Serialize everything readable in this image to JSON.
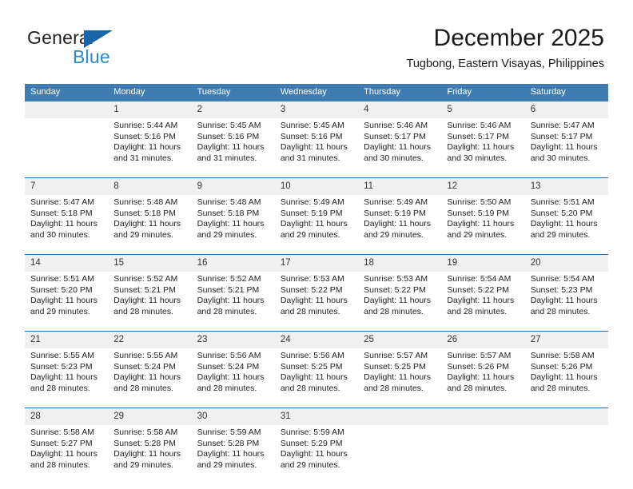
{
  "logo": {
    "word_primary": "General",
    "word_secondary": "Blue",
    "icon": "triangle-mark"
  },
  "header": {
    "title": "December 2025",
    "subtitle": "Tugbong, Eastern Visayas, Philippines"
  },
  "colors": {
    "header_blue": "#3e7cb1",
    "rule_blue": "#2f6fa8",
    "daynum_band": "#f0f0f0",
    "logo_blue": "#2b8ad6",
    "logo_triangle": "#1565a8",
    "text": "#222222"
  },
  "weekday_headers": [
    "Sunday",
    "Monday",
    "Tuesday",
    "Wednesday",
    "Thursday",
    "Friday",
    "Saturday"
  ],
  "labels": {
    "sunrise_prefix": "Sunrise:",
    "sunset_prefix": "Sunset:",
    "daylight_prefix": "Daylight:"
  },
  "weeks": [
    {
      "days": [
        {
          "num": "",
          "sunrise": "",
          "sunset": "",
          "daylight_1": "",
          "daylight_2": "",
          "empty": true
        },
        {
          "num": "1",
          "sunrise": "Sunrise: 5:44 AM",
          "sunset": "Sunset: 5:16 PM",
          "daylight_1": "Daylight: 11 hours",
          "daylight_2": "and 31 minutes.",
          "empty": false
        },
        {
          "num": "2",
          "sunrise": "Sunrise: 5:45 AM",
          "sunset": "Sunset: 5:16 PM",
          "daylight_1": "Daylight: 11 hours",
          "daylight_2": "and 31 minutes.",
          "empty": false
        },
        {
          "num": "3",
          "sunrise": "Sunrise: 5:45 AM",
          "sunset": "Sunset: 5:16 PM",
          "daylight_1": "Daylight: 11 hours",
          "daylight_2": "and 31 minutes.",
          "empty": false
        },
        {
          "num": "4",
          "sunrise": "Sunrise: 5:46 AM",
          "sunset": "Sunset: 5:17 PM",
          "daylight_1": "Daylight: 11 hours",
          "daylight_2": "and 30 minutes.",
          "empty": false
        },
        {
          "num": "5",
          "sunrise": "Sunrise: 5:46 AM",
          "sunset": "Sunset: 5:17 PM",
          "daylight_1": "Daylight: 11 hours",
          "daylight_2": "and 30 minutes.",
          "empty": false
        },
        {
          "num": "6",
          "sunrise": "Sunrise: 5:47 AM",
          "sunset": "Sunset: 5:17 PM",
          "daylight_1": "Daylight: 11 hours",
          "daylight_2": "and 30 minutes.",
          "empty": false
        }
      ]
    },
    {
      "days": [
        {
          "num": "7",
          "sunrise": "Sunrise: 5:47 AM",
          "sunset": "Sunset: 5:18 PM",
          "daylight_1": "Daylight: 11 hours",
          "daylight_2": "and 30 minutes.",
          "empty": false
        },
        {
          "num": "8",
          "sunrise": "Sunrise: 5:48 AM",
          "sunset": "Sunset: 5:18 PM",
          "daylight_1": "Daylight: 11 hours",
          "daylight_2": "and 29 minutes.",
          "empty": false
        },
        {
          "num": "9",
          "sunrise": "Sunrise: 5:48 AM",
          "sunset": "Sunset: 5:18 PM",
          "daylight_1": "Daylight: 11 hours",
          "daylight_2": "and 29 minutes.",
          "empty": false
        },
        {
          "num": "10",
          "sunrise": "Sunrise: 5:49 AM",
          "sunset": "Sunset: 5:19 PM",
          "daylight_1": "Daylight: 11 hours",
          "daylight_2": "and 29 minutes.",
          "empty": false
        },
        {
          "num": "11",
          "sunrise": "Sunrise: 5:49 AM",
          "sunset": "Sunset: 5:19 PM",
          "daylight_1": "Daylight: 11 hours",
          "daylight_2": "and 29 minutes.",
          "empty": false
        },
        {
          "num": "12",
          "sunrise": "Sunrise: 5:50 AM",
          "sunset": "Sunset: 5:19 PM",
          "daylight_1": "Daylight: 11 hours",
          "daylight_2": "and 29 minutes.",
          "empty": false
        },
        {
          "num": "13",
          "sunrise": "Sunrise: 5:51 AM",
          "sunset": "Sunset: 5:20 PM",
          "daylight_1": "Daylight: 11 hours",
          "daylight_2": "and 29 minutes.",
          "empty": false
        }
      ]
    },
    {
      "days": [
        {
          "num": "14",
          "sunrise": "Sunrise: 5:51 AM",
          "sunset": "Sunset: 5:20 PM",
          "daylight_1": "Daylight: 11 hours",
          "daylight_2": "and 29 minutes.",
          "empty": false
        },
        {
          "num": "15",
          "sunrise": "Sunrise: 5:52 AM",
          "sunset": "Sunset: 5:21 PM",
          "daylight_1": "Daylight: 11 hours",
          "daylight_2": "and 28 minutes.",
          "empty": false
        },
        {
          "num": "16",
          "sunrise": "Sunrise: 5:52 AM",
          "sunset": "Sunset: 5:21 PM",
          "daylight_1": "Daylight: 11 hours",
          "daylight_2": "and 28 minutes.",
          "empty": false
        },
        {
          "num": "17",
          "sunrise": "Sunrise: 5:53 AM",
          "sunset": "Sunset: 5:22 PM",
          "daylight_1": "Daylight: 11 hours",
          "daylight_2": "and 28 minutes.",
          "empty": false
        },
        {
          "num": "18",
          "sunrise": "Sunrise: 5:53 AM",
          "sunset": "Sunset: 5:22 PM",
          "daylight_1": "Daylight: 11 hours",
          "daylight_2": "and 28 minutes.",
          "empty": false
        },
        {
          "num": "19",
          "sunrise": "Sunrise: 5:54 AM",
          "sunset": "Sunset: 5:22 PM",
          "daylight_1": "Daylight: 11 hours",
          "daylight_2": "and 28 minutes.",
          "empty": false
        },
        {
          "num": "20",
          "sunrise": "Sunrise: 5:54 AM",
          "sunset": "Sunset: 5:23 PM",
          "daylight_1": "Daylight: 11 hours",
          "daylight_2": "and 28 minutes.",
          "empty": false
        }
      ]
    },
    {
      "days": [
        {
          "num": "21",
          "sunrise": "Sunrise: 5:55 AM",
          "sunset": "Sunset: 5:23 PM",
          "daylight_1": "Daylight: 11 hours",
          "daylight_2": "and 28 minutes.",
          "empty": false
        },
        {
          "num": "22",
          "sunrise": "Sunrise: 5:55 AM",
          "sunset": "Sunset: 5:24 PM",
          "daylight_1": "Daylight: 11 hours",
          "daylight_2": "and 28 minutes.",
          "empty": false
        },
        {
          "num": "23",
          "sunrise": "Sunrise: 5:56 AM",
          "sunset": "Sunset: 5:24 PM",
          "daylight_1": "Daylight: 11 hours",
          "daylight_2": "and 28 minutes.",
          "empty": false
        },
        {
          "num": "24",
          "sunrise": "Sunrise: 5:56 AM",
          "sunset": "Sunset: 5:25 PM",
          "daylight_1": "Daylight: 11 hours",
          "daylight_2": "and 28 minutes.",
          "empty": false
        },
        {
          "num": "25",
          "sunrise": "Sunrise: 5:57 AM",
          "sunset": "Sunset: 5:25 PM",
          "daylight_1": "Daylight: 11 hours",
          "daylight_2": "and 28 minutes.",
          "empty": false
        },
        {
          "num": "26",
          "sunrise": "Sunrise: 5:57 AM",
          "sunset": "Sunset: 5:26 PM",
          "daylight_1": "Daylight: 11 hours",
          "daylight_2": "and 28 minutes.",
          "empty": false
        },
        {
          "num": "27",
          "sunrise": "Sunrise: 5:58 AM",
          "sunset": "Sunset: 5:26 PM",
          "daylight_1": "Daylight: 11 hours",
          "daylight_2": "and 28 minutes.",
          "empty": false
        }
      ]
    },
    {
      "days": [
        {
          "num": "28",
          "sunrise": "Sunrise: 5:58 AM",
          "sunset": "Sunset: 5:27 PM",
          "daylight_1": "Daylight: 11 hours",
          "daylight_2": "and 28 minutes.",
          "empty": false
        },
        {
          "num": "29",
          "sunrise": "Sunrise: 5:58 AM",
          "sunset": "Sunset: 5:28 PM",
          "daylight_1": "Daylight: 11 hours",
          "daylight_2": "and 29 minutes.",
          "empty": false
        },
        {
          "num": "30",
          "sunrise": "Sunrise: 5:59 AM",
          "sunset": "Sunset: 5:28 PM",
          "daylight_1": "Daylight: 11 hours",
          "daylight_2": "and 29 minutes.",
          "empty": false
        },
        {
          "num": "31",
          "sunrise": "Sunrise: 5:59 AM",
          "sunset": "Sunset: 5:29 PM",
          "daylight_1": "Daylight: 11 hours",
          "daylight_2": "and 29 minutes.",
          "empty": false
        },
        {
          "num": "",
          "sunrise": "",
          "sunset": "",
          "daylight_1": "",
          "daylight_2": "",
          "empty": true
        },
        {
          "num": "",
          "sunrise": "",
          "sunset": "",
          "daylight_1": "",
          "daylight_2": "",
          "empty": true
        },
        {
          "num": "",
          "sunrise": "",
          "sunset": "",
          "daylight_1": "",
          "daylight_2": "",
          "empty": true
        }
      ]
    }
  ]
}
